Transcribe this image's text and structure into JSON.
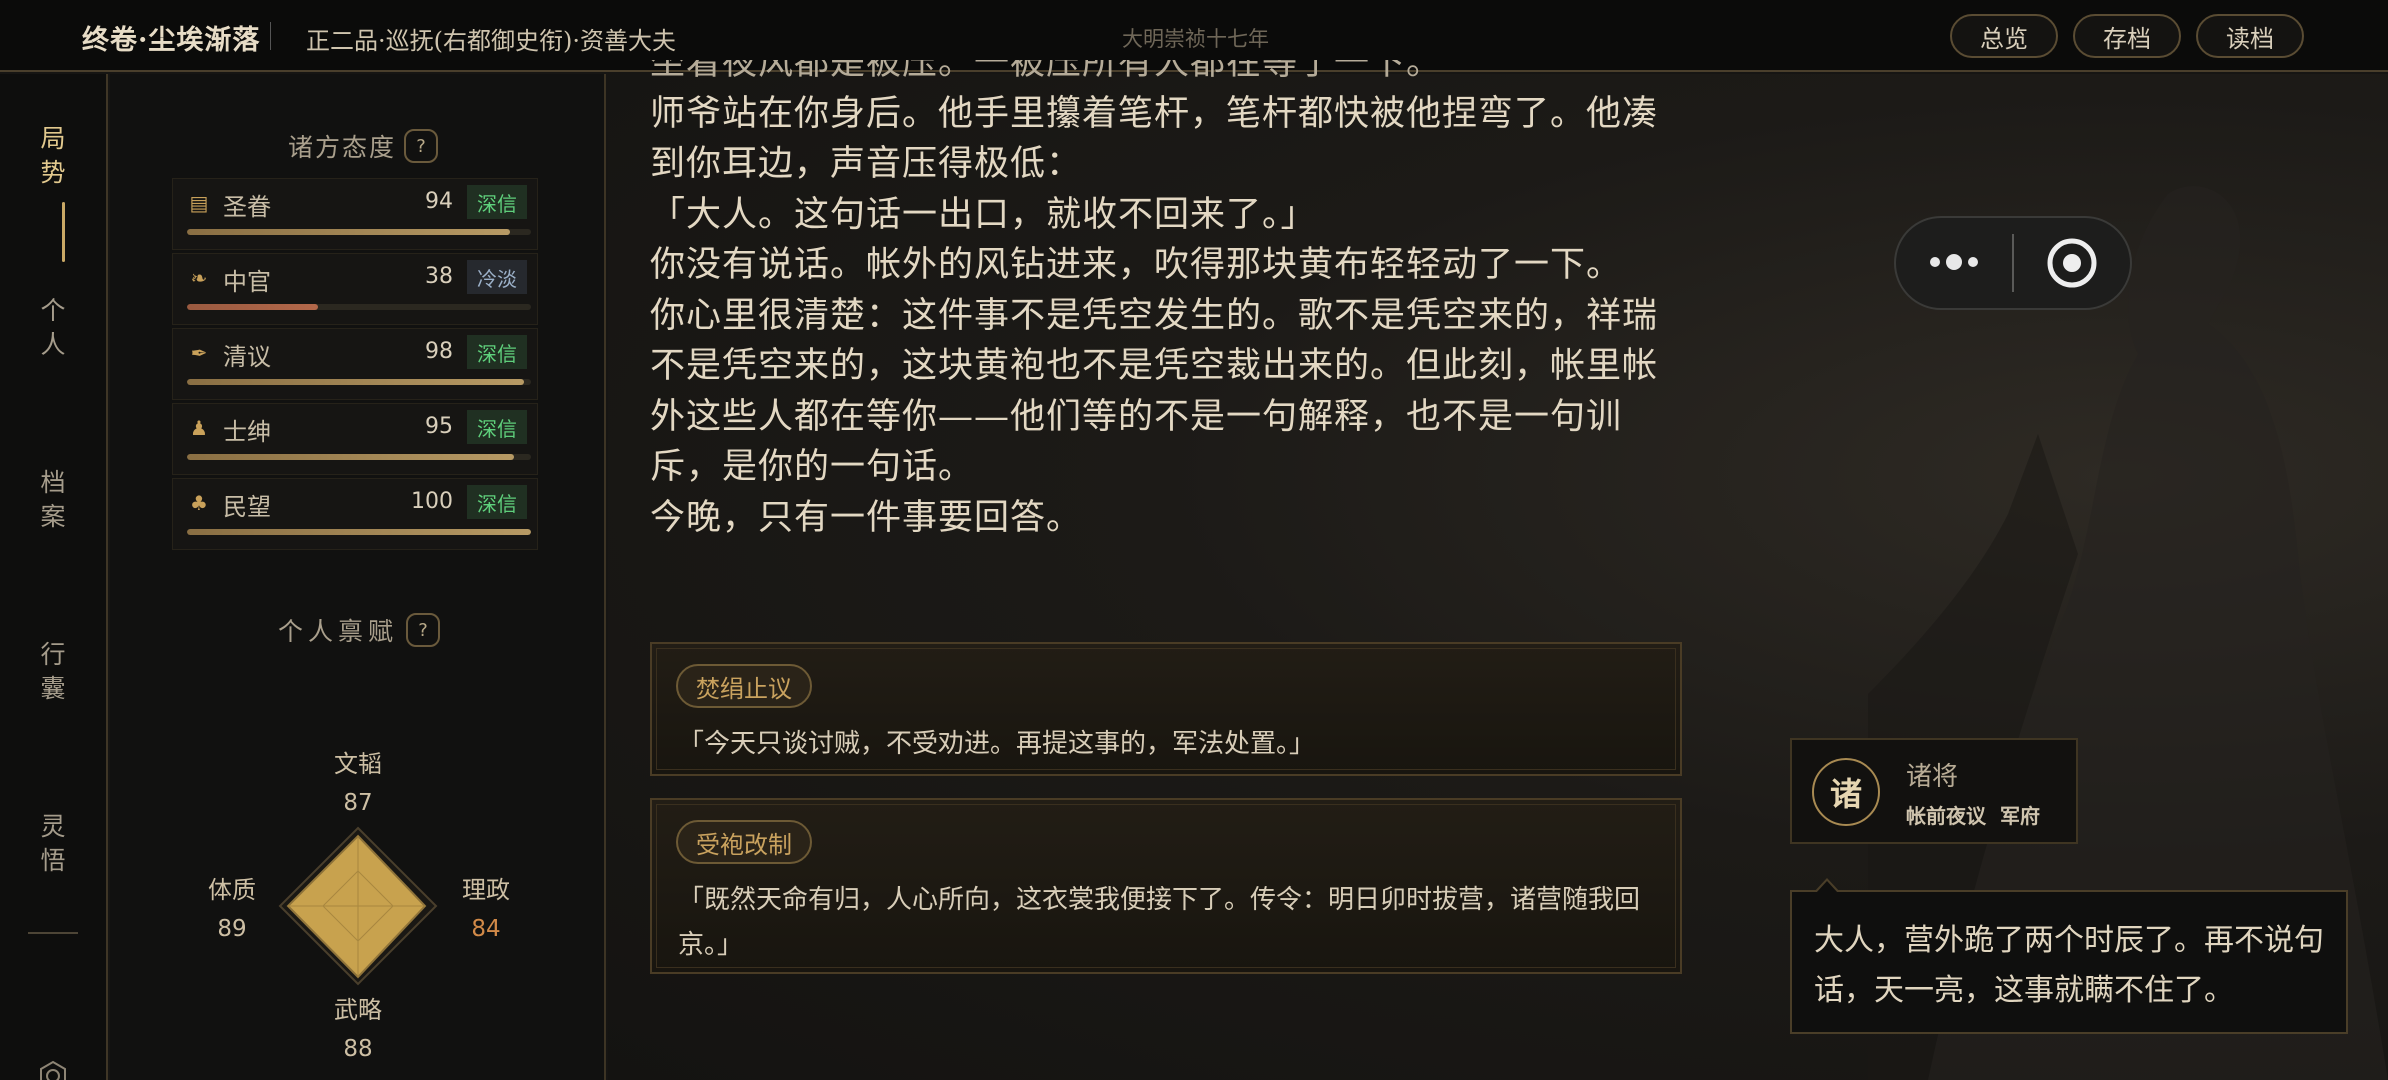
{
  "topbar": {
    "game_title": "终卷·尘埃渐落",
    "rank": "正二品·巡抚(右都御史衔)·资善大夫",
    "era": "大明崇祯十七年",
    "buttons": {
      "overview": "总览",
      "save": "存档",
      "load": "读档"
    }
  },
  "nav": {
    "items": [
      {
        "label_top": "局",
        "label_bottom": "势",
        "active": true
      },
      {
        "label_top": "个",
        "label_bottom": "人",
        "active": false
      },
      {
        "label_top": "档",
        "label_bottom": "案",
        "active": false
      },
      {
        "label_top": "行",
        "label_bottom": "囊",
        "active": false
      },
      {
        "label_top": "灵",
        "label_bottom": "悟",
        "active": false
      }
    ],
    "settings_icon": "settings-icon"
  },
  "attitudes": {
    "title": "诸方态度",
    "help": "?",
    "items": [
      {
        "name": "圣眷",
        "value": "94",
        "level": 0.94,
        "badge": "深信",
        "icon": "scroll-icon"
      },
      {
        "name": "中官",
        "value": "38",
        "level": 0.38,
        "badge": "冷淡",
        "icon": "bird-icon"
      },
      {
        "name": "清议",
        "value": "98",
        "level": 0.98,
        "badge": "深信",
        "icon": "quill-icon"
      },
      {
        "name": "士绅",
        "value": "95",
        "level": 0.95,
        "badge": "深信",
        "icon": "scholar-icon"
      },
      {
        "name": "民望",
        "value": "100",
        "level": 1.0,
        "badge": "深信",
        "icon": "crowd-icon"
      }
    ]
  },
  "talents": {
    "title": "个人禀赋",
    "help": "?",
    "axes": [
      {
        "label": "文韬",
        "value": "87"
      },
      {
        "label": "理政",
        "value": "84"
      },
      {
        "label": "武略",
        "value": "88"
      },
      {
        "label": "体质",
        "value": "89"
      }
    ]
  },
  "story": {
    "clipped_line": "坐着夜风都是被压。一被压所有人都在等了一下。",
    "paragraphs": [
      "师爷站在你身后。他手里攥着笔杆，笔杆都快被他捏弯了。他凑到你耳边，声音压得极低：",
      "「大人。这句话一出口，就收不回来了。」",
      "你没有说话。帐外的风钻进来，吹得那块黄布轻轻动了一下。",
      "你心里很清楚：这件事不是凭空发生的。歌不是凭空来的，祥瑞不是凭空来的，这块黄袍也不是凭空裁出来的。但此刻，帐里帐外这些人都在等你——他们等的不是一句解释，也不是一句训斥，是你的一句话。",
      "今晚，只有一件事要回答。"
    ]
  },
  "choices": [
    {
      "tag": "焚绢止议",
      "text": "「今天只谈讨贼，不受劝进。再提这事的，军法处置。」"
    },
    {
      "tag": "受袍改制",
      "text": "「既然天命有归，人心所向，这衣裳我便接下了。传令：明日卯时拔营，诸营随我回京。」"
    }
  ],
  "speaker": {
    "avatar_char": "诸",
    "name": "诸将",
    "tags": [
      "帐前夜议",
      "军府"
    ],
    "line": "大人，营外跪了两个时辰了。再不说句话，天一亮，这事就瞒不住了。"
  },
  "colors": {
    "accent_gold": "#c9a865",
    "trust_green": "#5fd07c",
    "cold_blue": "#9bb0c8",
    "bg": "#161513"
  }
}
